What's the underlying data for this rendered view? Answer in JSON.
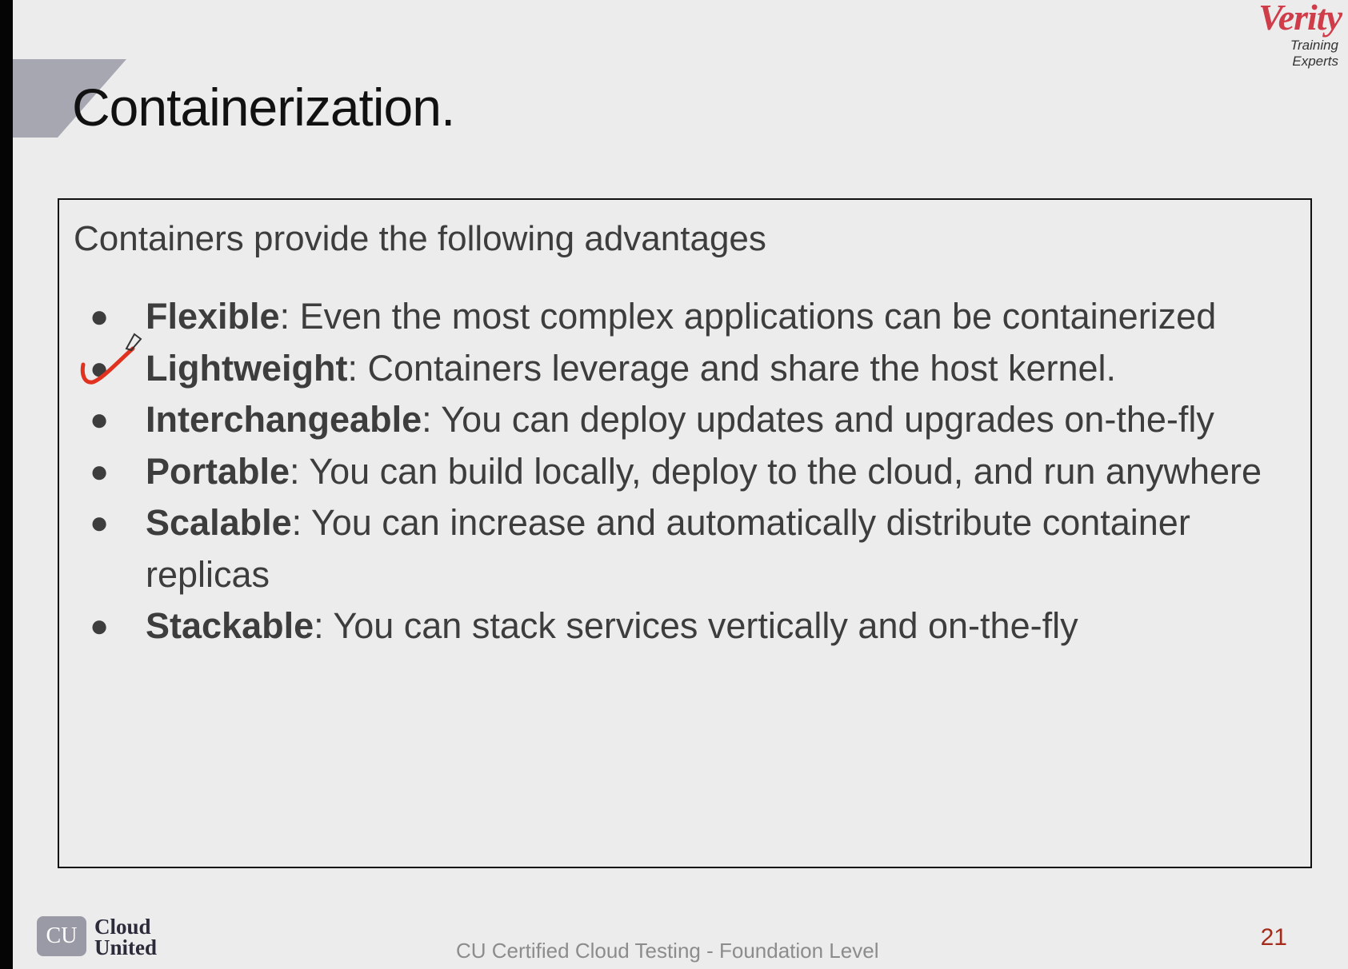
{
  "slide": {
    "title": "Containerization.",
    "intro": "Containers provide the following advantages",
    "advantages": [
      {
        "term": "Flexible",
        "description": ": Even the most complex applications can be containerized"
      },
      {
        "term": "Lightweight",
        "description": ": Containers leverage and share the host kernel."
      },
      {
        "term": "Interchangeable",
        "description": ": You can deploy updates and upgrades on-the-fly"
      },
      {
        "term": "Portable",
        "description": ": You can build locally, deploy to the cloud, and run anywhere"
      },
      {
        "term": "Scalable",
        "description": ": You can increase and automatically distribute container replicas"
      },
      {
        "term": "Stackable",
        "description": ": You can stack services vertically and on-the-fly"
      }
    ],
    "bullet_glyph": "●"
  },
  "branding": {
    "company": "Verity",
    "tagline": "Training Experts",
    "footer_logo_badge": "CU",
    "footer_logo_line1": "Cloud",
    "footer_logo_line2": "United"
  },
  "footer": {
    "course": "CU Certified Cloud Testing - Foundation Level",
    "page_number": "21"
  },
  "annotation": {
    "icon": "checkmark-icon",
    "target_item": "Lightweight",
    "color": "#e0321e"
  },
  "colors": {
    "title_accent": "#a7a7b1",
    "brand_red": "#cf3d4a",
    "page_number": "#a52a1a"
  }
}
